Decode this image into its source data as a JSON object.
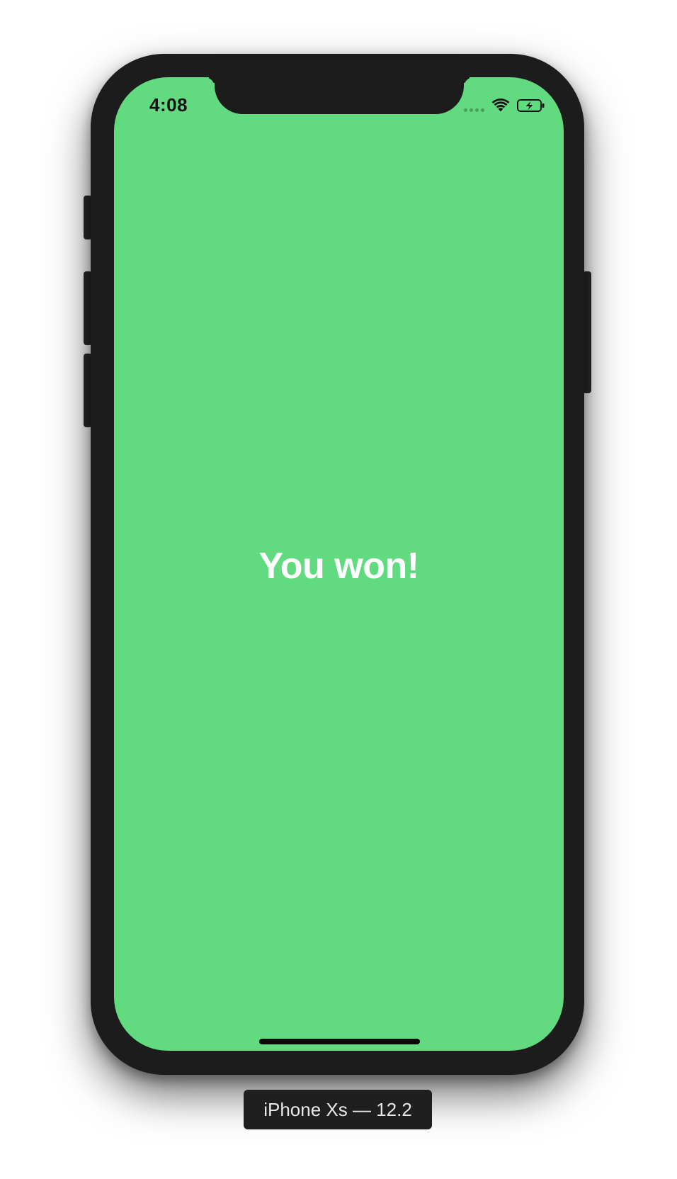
{
  "status_bar": {
    "time": "4:08",
    "icons": [
      "signal-dots-icon",
      "wifi-icon",
      "battery-charging-icon"
    ]
  },
  "app": {
    "message": "You won!",
    "background_color": "#62da80",
    "message_color": "#ffffff"
  },
  "simulator": {
    "device_label": "iPhone Xs — 12.2"
  }
}
